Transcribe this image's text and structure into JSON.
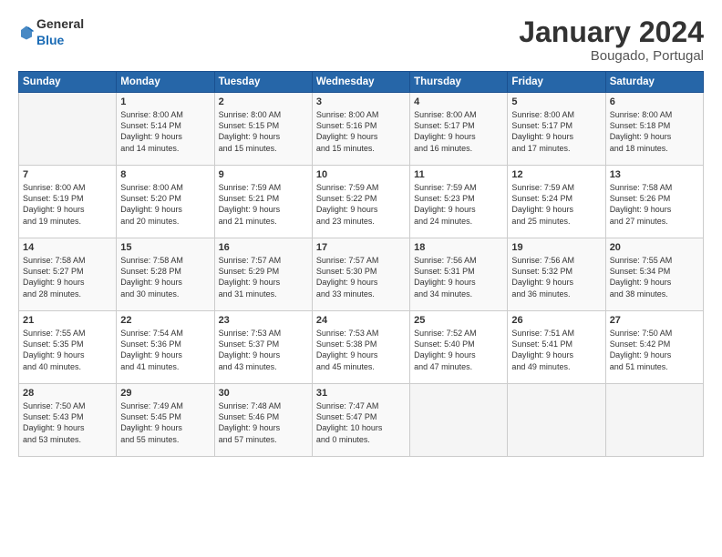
{
  "header": {
    "logo_general": "General",
    "logo_blue": "Blue",
    "title": "January 2024",
    "subtitle": "Bougado, Portugal"
  },
  "columns": [
    "Sunday",
    "Monday",
    "Tuesday",
    "Wednesday",
    "Thursday",
    "Friday",
    "Saturday"
  ],
  "weeks": [
    [
      {
        "day": "",
        "info": ""
      },
      {
        "day": "1",
        "info": "Sunrise: 8:00 AM\nSunset: 5:14 PM\nDaylight: 9 hours\nand 14 minutes."
      },
      {
        "day": "2",
        "info": "Sunrise: 8:00 AM\nSunset: 5:15 PM\nDaylight: 9 hours\nand 15 minutes."
      },
      {
        "day": "3",
        "info": "Sunrise: 8:00 AM\nSunset: 5:16 PM\nDaylight: 9 hours\nand 15 minutes."
      },
      {
        "day": "4",
        "info": "Sunrise: 8:00 AM\nSunset: 5:17 PM\nDaylight: 9 hours\nand 16 minutes."
      },
      {
        "day": "5",
        "info": "Sunrise: 8:00 AM\nSunset: 5:17 PM\nDaylight: 9 hours\nand 17 minutes."
      },
      {
        "day": "6",
        "info": "Sunrise: 8:00 AM\nSunset: 5:18 PM\nDaylight: 9 hours\nand 18 minutes."
      }
    ],
    [
      {
        "day": "7",
        "info": "Sunrise: 8:00 AM\nSunset: 5:19 PM\nDaylight: 9 hours\nand 19 minutes."
      },
      {
        "day": "8",
        "info": "Sunrise: 8:00 AM\nSunset: 5:20 PM\nDaylight: 9 hours\nand 20 minutes."
      },
      {
        "day": "9",
        "info": "Sunrise: 7:59 AM\nSunset: 5:21 PM\nDaylight: 9 hours\nand 21 minutes."
      },
      {
        "day": "10",
        "info": "Sunrise: 7:59 AM\nSunset: 5:22 PM\nDaylight: 9 hours\nand 23 minutes."
      },
      {
        "day": "11",
        "info": "Sunrise: 7:59 AM\nSunset: 5:23 PM\nDaylight: 9 hours\nand 24 minutes."
      },
      {
        "day": "12",
        "info": "Sunrise: 7:59 AM\nSunset: 5:24 PM\nDaylight: 9 hours\nand 25 minutes."
      },
      {
        "day": "13",
        "info": "Sunrise: 7:58 AM\nSunset: 5:26 PM\nDaylight: 9 hours\nand 27 minutes."
      }
    ],
    [
      {
        "day": "14",
        "info": "Sunrise: 7:58 AM\nSunset: 5:27 PM\nDaylight: 9 hours\nand 28 minutes."
      },
      {
        "day": "15",
        "info": "Sunrise: 7:58 AM\nSunset: 5:28 PM\nDaylight: 9 hours\nand 30 minutes."
      },
      {
        "day": "16",
        "info": "Sunrise: 7:57 AM\nSunset: 5:29 PM\nDaylight: 9 hours\nand 31 minutes."
      },
      {
        "day": "17",
        "info": "Sunrise: 7:57 AM\nSunset: 5:30 PM\nDaylight: 9 hours\nand 33 minutes."
      },
      {
        "day": "18",
        "info": "Sunrise: 7:56 AM\nSunset: 5:31 PM\nDaylight: 9 hours\nand 34 minutes."
      },
      {
        "day": "19",
        "info": "Sunrise: 7:56 AM\nSunset: 5:32 PM\nDaylight: 9 hours\nand 36 minutes."
      },
      {
        "day": "20",
        "info": "Sunrise: 7:55 AM\nSunset: 5:34 PM\nDaylight: 9 hours\nand 38 minutes."
      }
    ],
    [
      {
        "day": "21",
        "info": "Sunrise: 7:55 AM\nSunset: 5:35 PM\nDaylight: 9 hours\nand 40 minutes."
      },
      {
        "day": "22",
        "info": "Sunrise: 7:54 AM\nSunset: 5:36 PM\nDaylight: 9 hours\nand 41 minutes."
      },
      {
        "day": "23",
        "info": "Sunrise: 7:53 AM\nSunset: 5:37 PM\nDaylight: 9 hours\nand 43 minutes."
      },
      {
        "day": "24",
        "info": "Sunrise: 7:53 AM\nSunset: 5:38 PM\nDaylight: 9 hours\nand 45 minutes."
      },
      {
        "day": "25",
        "info": "Sunrise: 7:52 AM\nSunset: 5:40 PM\nDaylight: 9 hours\nand 47 minutes."
      },
      {
        "day": "26",
        "info": "Sunrise: 7:51 AM\nSunset: 5:41 PM\nDaylight: 9 hours\nand 49 minutes."
      },
      {
        "day": "27",
        "info": "Sunrise: 7:50 AM\nSunset: 5:42 PM\nDaylight: 9 hours\nand 51 minutes."
      }
    ],
    [
      {
        "day": "28",
        "info": "Sunrise: 7:50 AM\nSunset: 5:43 PM\nDaylight: 9 hours\nand 53 minutes."
      },
      {
        "day": "29",
        "info": "Sunrise: 7:49 AM\nSunset: 5:45 PM\nDaylight: 9 hours\nand 55 minutes."
      },
      {
        "day": "30",
        "info": "Sunrise: 7:48 AM\nSunset: 5:46 PM\nDaylight: 9 hours\nand 57 minutes."
      },
      {
        "day": "31",
        "info": "Sunrise: 7:47 AM\nSunset: 5:47 PM\nDaylight: 10 hours\nand 0 minutes."
      },
      {
        "day": "",
        "info": ""
      },
      {
        "day": "",
        "info": ""
      },
      {
        "day": "",
        "info": ""
      }
    ]
  ]
}
